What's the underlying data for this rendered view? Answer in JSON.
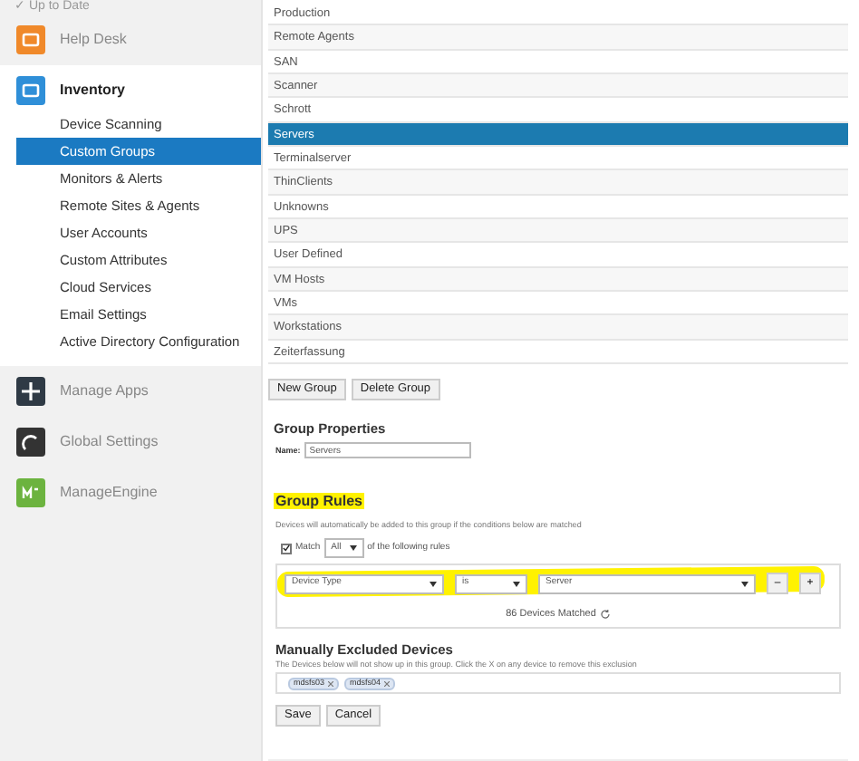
{
  "sidebar": {
    "status": "✓ Up to Date",
    "items": [
      {
        "label": "Help Desk",
        "kind": "app",
        "expanded": false,
        "color": "#f0892a"
      },
      {
        "label": "Inventory",
        "kind": "app",
        "expanded": true,
        "color": "#2f8fd8",
        "children": [
          {
            "label": "Device Scanning",
            "selected": false
          },
          {
            "label": "Custom Groups",
            "selected": true
          },
          {
            "label": "Monitors & Alerts",
            "selected": false
          },
          {
            "label": "Remote Sites & Agents",
            "selected": false
          },
          {
            "label": "User Accounts",
            "selected": false
          },
          {
            "label": "Custom Attributes",
            "selected": false
          },
          {
            "label": "Cloud Services",
            "selected": false
          },
          {
            "label": "Email Settings",
            "selected": false
          },
          {
            "label": "Active Directory Configuration",
            "selected": false
          }
        ]
      },
      {
        "label": "Manage Apps",
        "kind": "plus",
        "expanded": false,
        "color": "#2f3a45"
      },
      {
        "label": "Global Settings",
        "kind": "gauge",
        "expanded": false,
        "color": "#333333"
      },
      {
        "label": "ManageEngine",
        "kind": "logo",
        "expanded": false,
        "color": "#6cb33f"
      }
    ]
  },
  "groups": [
    {
      "label": "Production",
      "selected": false
    },
    {
      "label": "Remote Agents",
      "selected": false
    },
    {
      "label": "SAN",
      "selected": false
    },
    {
      "label": "Scanner",
      "selected": false
    },
    {
      "label": "Schrott",
      "selected": false
    },
    {
      "label": "Servers",
      "selected": true
    },
    {
      "label": "Terminalserver",
      "selected": false
    },
    {
      "label": "ThinClients",
      "selected": false
    },
    {
      "label": "Unknowns",
      "selected": false
    },
    {
      "label": "UPS",
      "selected": false
    },
    {
      "label": "User Defined",
      "selected": false
    },
    {
      "label": "VM Hosts",
      "selected": false
    },
    {
      "label": "VMs",
      "selected": false
    },
    {
      "label": "Workstations",
      "selected": false
    },
    {
      "label": "Zeiterfassung",
      "selected": false
    }
  ],
  "group_buttons": [
    "New Group",
    "Delete Group"
  ],
  "properties": {
    "title": "Group Properties",
    "name_label": "Name:",
    "name_value": "Servers"
  },
  "rules": {
    "title": "Group Rules",
    "description": "Devices will automatically be added to this group if the conditions below are matched",
    "match_label": "Match",
    "match_checked": true,
    "match_value": "All",
    "match_suffix": "of the following rules",
    "rule": {
      "field": "Device Type",
      "operator": "is",
      "value": "Server",
      "remove": "–",
      "add": "+"
    },
    "matched": "86 Devices Matched"
  },
  "excluded": {
    "title": "Manually Excluded Devices",
    "description": "The Devices below will not show up in this group. Click the X on any device to remove this exclusion",
    "devices": [
      "mdsfs03",
      "mdsfs04"
    ]
  },
  "form_buttons": [
    "Save",
    "Cancel"
  ]
}
